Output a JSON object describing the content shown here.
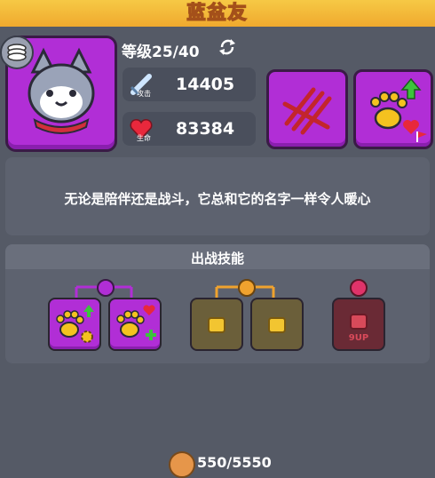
{
  "header": {
    "title": "蓝盆友"
  },
  "pet": {
    "level_text": "等级25/40",
    "attack_label": "攻击",
    "attack_value": "14405",
    "hp_label": "生命",
    "hp_value": "83384",
    "description": "无论是陪伴还是战斗，它总和它的名字一样令人暖心"
  },
  "skills": {
    "title": "出战技能",
    "groups": [
      {
        "color": "#b12ed6",
        "state": "unlocked"
      },
      {
        "color": "#f0a22e",
        "state": "locked"
      },
      {
        "color": "#e0336a",
        "state": "locked"
      }
    ],
    "locked_badge": "9UP"
  },
  "footer": {
    "currency": "550/5550"
  },
  "colors": {
    "accent": "#b12ed6",
    "header": "#f3b83a",
    "background": "#555a66"
  }
}
